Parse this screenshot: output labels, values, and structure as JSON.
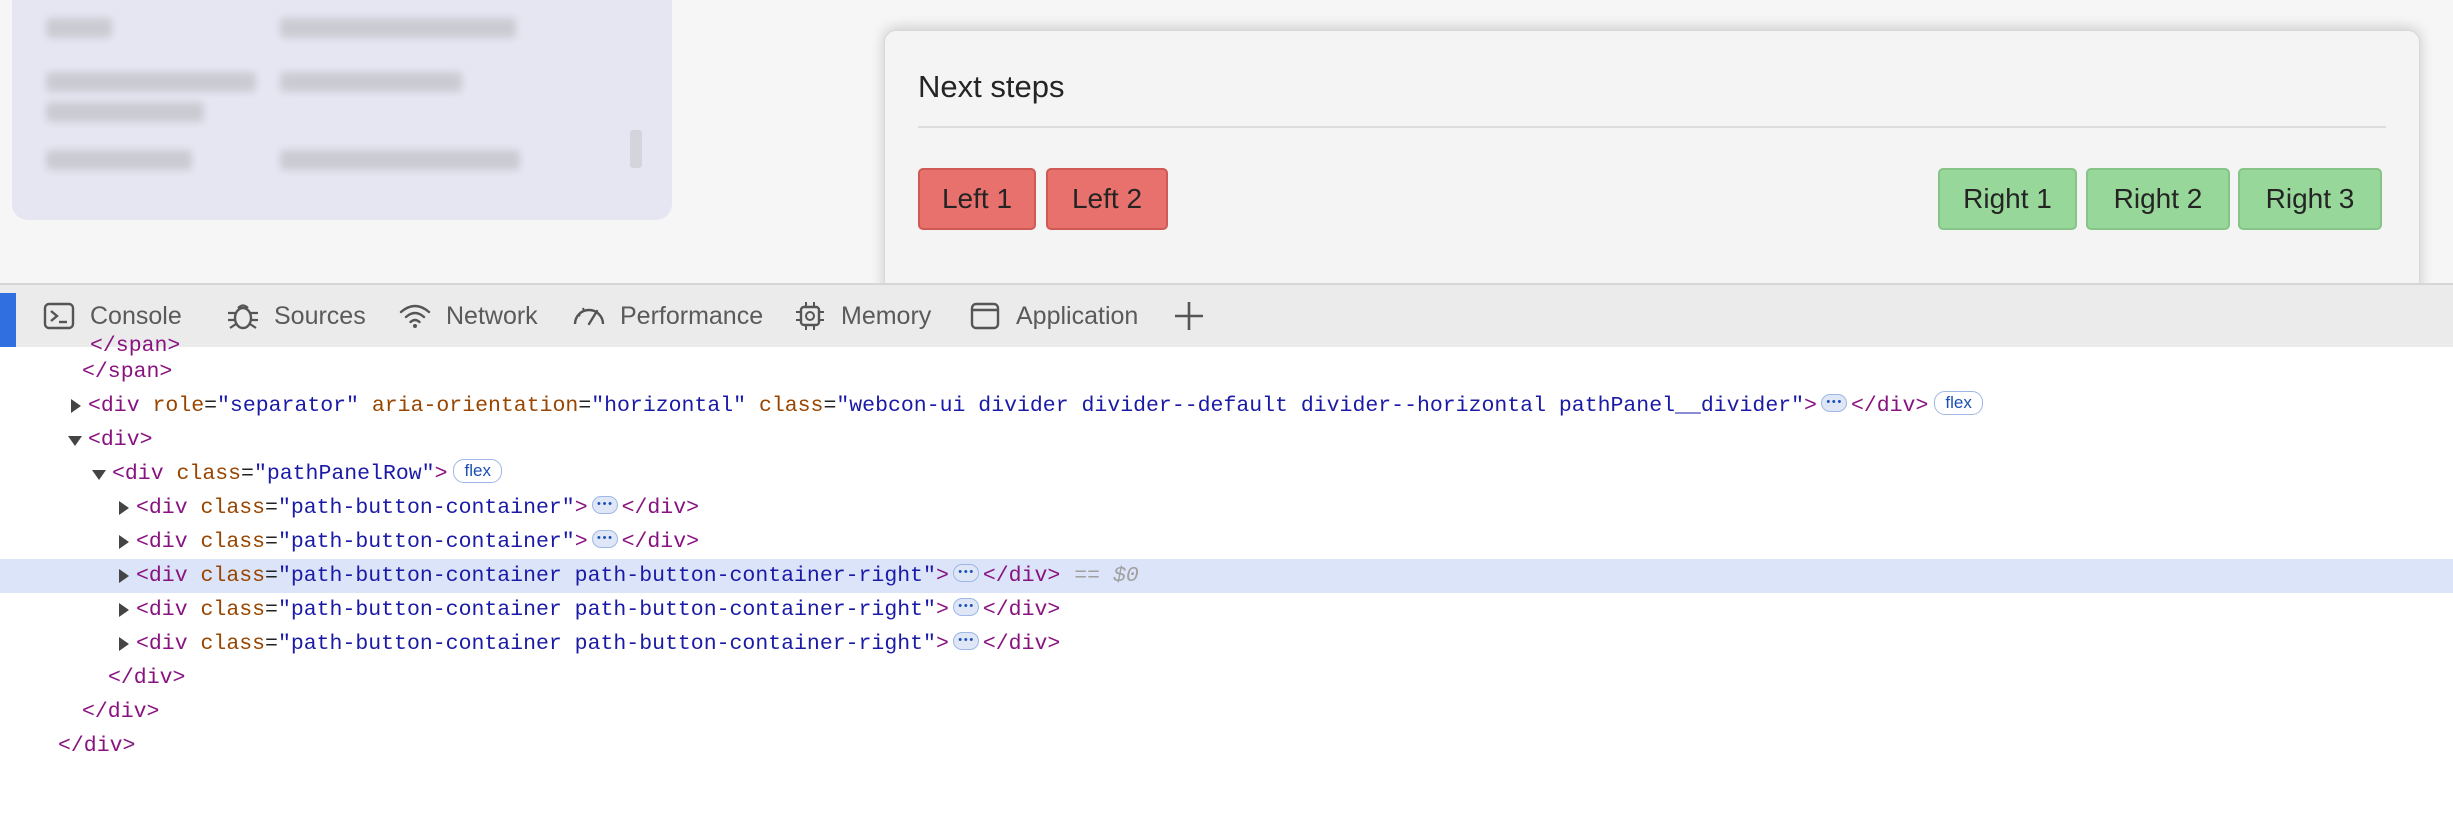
{
  "next_steps": {
    "title": "Next steps",
    "left_buttons": [
      "Left 1",
      "Left 2"
    ],
    "right_buttons": [
      "Right 1",
      "Right 2",
      "Right 3"
    ],
    "colors": {
      "left": "#e8716d",
      "right": "#98d79a"
    }
  },
  "devtools": {
    "tabs": [
      {
        "label": "Console",
        "icon": "console-icon"
      },
      {
        "label": "Sources",
        "icon": "sources-bug-icon"
      },
      {
        "label": "Network",
        "icon": "wifi-icon"
      },
      {
        "label": "Performance",
        "icon": "gauge-icon"
      },
      {
        "label": "Memory",
        "icon": "chip-icon"
      },
      {
        "label": "Application",
        "icon": "window-icon"
      }
    ],
    "add_tab_icon": "plus-icon"
  },
  "dom": {
    "close_span": "</span>",
    "separator": {
      "tag_open": "<div",
      "role_attr": "role",
      "role_val": "\"separator\"",
      "orient_attr": "aria-orientation",
      "orient_val": "\"horizontal\"",
      "class_attr": "class",
      "class_val": "\"webcon-ui divider divider--default divider--horizontal pathPanel__divider\"",
      "close": "</div>",
      "badge": "flex"
    },
    "div_open": "<div>",
    "row": {
      "tag_open": "<div",
      "class_attr": "class",
      "class_val": "\"pathPanelRow\"",
      "badge": "flex"
    },
    "containers": [
      {
        "class_val": "\"path-button-container\"",
        "selected": false
      },
      {
        "class_val": "\"path-button-container\"",
        "selected": false
      },
      {
        "class_val": "\"path-button-container path-button-container-right\"",
        "selected": true
      },
      {
        "class_val": "\"path-button-container path-button-container-right\"",
        "selected": false
      },
      {
        "class_val": "\"path-button-container path-button-container-right\"",
        "selected": false
      }
    ],
    "selected_marker": "== $0",
    "div_close": "</div>"
  }
}
